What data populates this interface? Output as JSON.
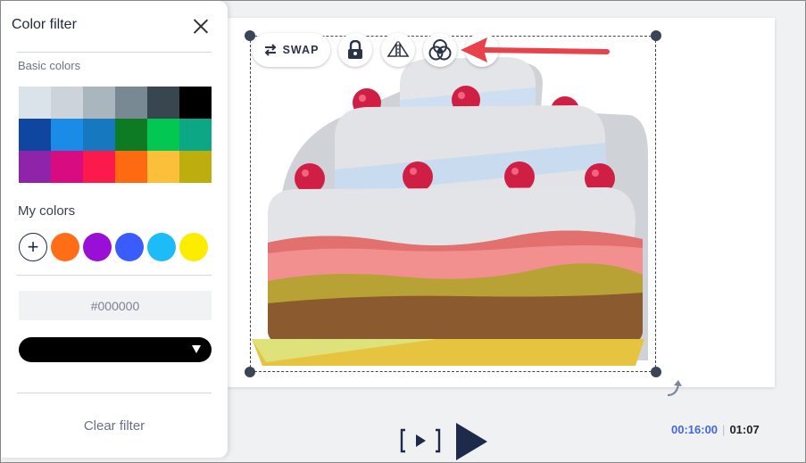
{
  "panel": {
    "title": "Color filter",
    "basic_colors_label": "Basic colors",
    "basic_colors": [
      "#dbe3ea",
      "#ccd3da",
      "#aab6be",
      "#788993",
      "#38474f",
      "#000000",
      "#0f47a0",
      "#1a8ce8",
      "#1679bf",
      "#0c7b24",
      "#02c753",
      "#0ca886",
      "#8f24aa",
      "#d80c80",
      "#fb1a4b",
      "#fd6a12",
      "#fbbf39",
      "#beae0d"
    ],
    "my_colors_label": "My colors",
    "my_colors": [
      "#ff6d17",
      "#9a0fd6",
      "#3a5cff",
      "#1dbcf8",
      "#fbec00"
    ],
    "add_symbol": "+",
    "hex_value": "#000000",
    "selected_color": "#000000",
    "clear_filter_label": "Clear filter"
  },
  "toolbar": {
    "swap_label": "SWAP"
  },
  "playback": {
    "current_time": "00:16:00",
    "separator": "|",
    "total_time": "01:07"
  },
  "colors": {
    "accent_blue": "#4468d8",
    "dark_navy": "#1e2a4a",
    "annotation_red": "#e8434a"
  }
}
